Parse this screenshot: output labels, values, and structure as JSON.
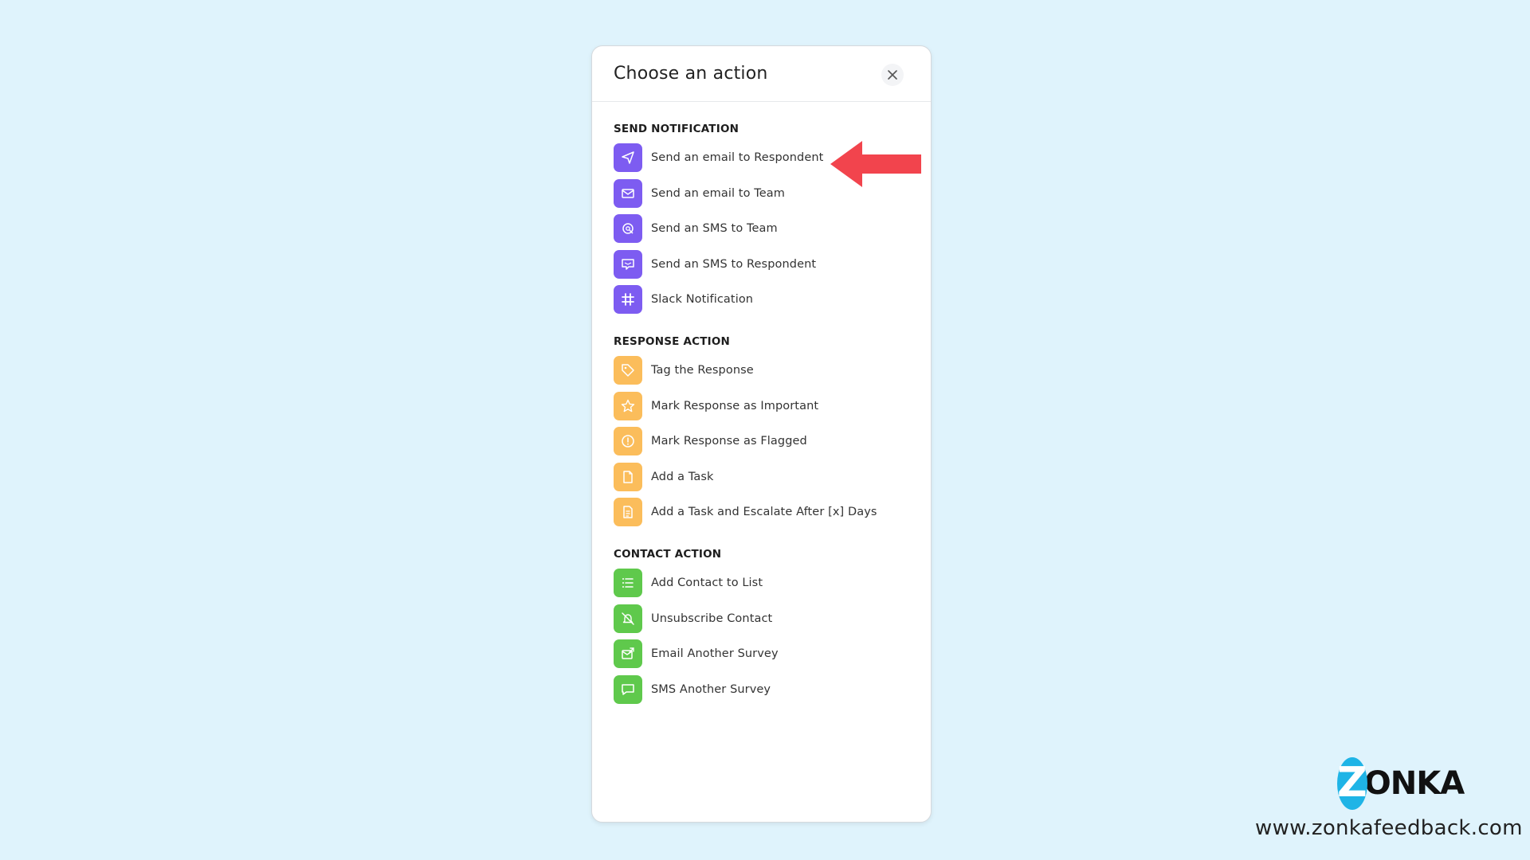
{
  "modal": {
    "title": "Choose an action"
  },
  "sections": [
    {
      "title": "SEND NOTIFICATION",
      "color": "#7d5cf1",
      "items": [
        {
          "label": "Send an email to Respondent",
          "icon": "send-icon"
        },
        {
          "label": "Send an email to Team",
          "icon": "mail-icon"
        },
        {
          "label": "Send an SMS to Team",
          "icon": "sms-team-icon"
        },
        {
          "label": "Send an SMS to Respondent",
          "icon": "sms-respondent-icon"
        },
        {
          "label": "Slack Notification",
          "icon": "slack-icon"
        }
      ]
    },
    {
      "title": "RESPONSE ACTION",
      "color": "#fbbd5b",
      "items": [
        {
          "label": "Tag the Response",
          "icon": "tag-icon"
        },
        {
          "label": "Mark Response as Important",
          "icon": "star-icon"
        },
        {
          "label": "Mark Response as Flagged",
          "icon": "flag-circle-icon"
        },
        {
          "label": "Add a Task",
          "icon": "task-icon"
        },
        {
          "label": "Add a Task and Escalate After [x] Days",
          "icon": "escalate-task-icon"
        }
      ]
    },
    {
      "title": "CONTACT ACTION",
      "color": "#5fc94c",
      "items": [
        {
          "label": "Add Contact to List",
          "icon": "list-icon"
        },
        {
          "label": "Unsubscribe Contact",
          "icon": "unsubscribe-icon"
        },
        {
          "label": "Email Another Survey",
          "icon": "email-survey-icon"
        },
        {
          "label": "SMS Another Survey",
          "icon": "sms-survey-icon"
        }
      ]
    }
  ],
  "branding": {
    "logo_letter": "Z",
    "logo_text": "ONKA",
    "website": "www.zonkafeedback.com",
    "logo_color": "#1fb4e6"
  },
  "annotation": {
    "arrow_color": "#f2444d"
  }
}
